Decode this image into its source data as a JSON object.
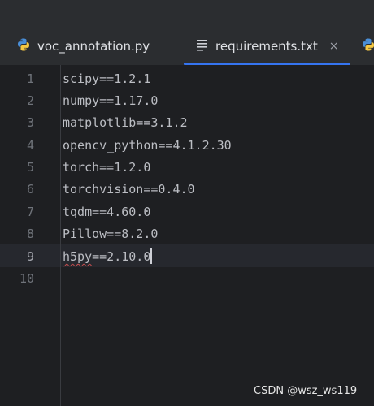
{
  "tabs": [
    {
      "label": "voc_annotation.py",
      "icon": "python-icon",
      "active": false
    },
    {
      "label": "requirements.txt",
      "icon": "text-file-icon",
      "active": true,
      "close": "×"
    }
  ],
  "editor": {
    "lines": [
      {
        "number": "1",
        "text": "scipy==1.2.1"
      },
      {
        "number": "2",
        "text": "numpy==1.17.0"
      },
      {
        "number": "3",
        "text": "matplotlib==3.1.2"
      },
      {
        "number": "4",
        "text": "opencv_python==4.1.2.30"
      },
      {
        "number": "5",
        "text": "torch==1.2.0"
      },
      {
        "number": "6",
        "text": "torchvision==0.4.0"
      },
      {
        "number": "7",
        "text": "tqdm==4.60.0"
      },
      {
        "number": "8",
        "text": "Pillow==8.2.0"
      },
      {
        "number": "9",
        "text_misspelled": "h5py",
        "text_rest": "==2.10.0"
      },
      {
        "number": "10",
        "text": ""
      }
    ]
  },
  "watermark": "CSDN @wsz_ws119",
  "colors": {
    "background": "#1e1f22",
    "tab_bar": "#2b2d30",
    "accent": "#3574f0",
    "text": "#bcbec4",
    "line_number": "#6f737a",
    "python_blue": "#4a8fd8",
    "python_yellow": "#f5c842"
  }
}
